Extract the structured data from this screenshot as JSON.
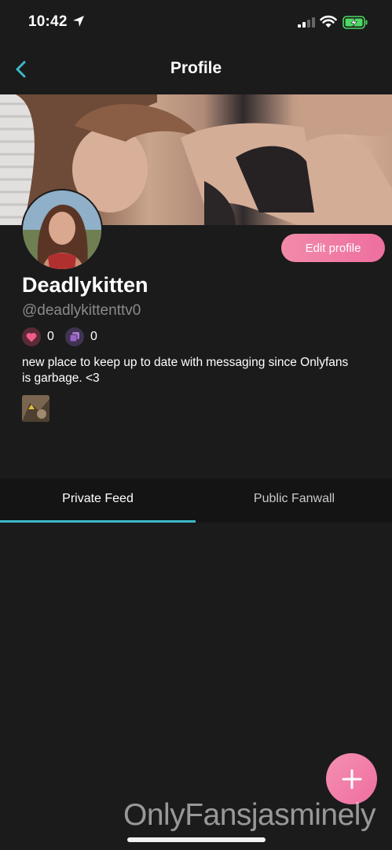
{
  "status_bar": {
    "time": "10:42",
    "icons": [
      "location-arrow-icon",
      "cellular-signal-icon",
      "wifi-icon",
      "battery-charging-icon"
    ],
    "battery_color": "#4cd964"
  },
  "navbar": {
    "title": "Profile",
    "back_icon": "chevron-left-icon",
    "accent": "#3cb8c8"
  },
  "profile": {
    "display_name": "Deadlykitten",
    "handle": "@deadlykittenttv0",
    "edit_label": "Edit profile",
    "likes_count": "0",
    "posts_count": "0",
    "bio": "new place to keep up to date with messaging since Onlyfans is garbage. <3"
  },
  "tabs": [
    {
      "label": "Private Feed",
      "active": true
    },
    {
      "label": "Public Fanwall",
      "active": false
    }
  ],
  "fab": {
    "icon": "plus-icon",
    "color": "#f07aa6"
  },
  "watermark": "OnlyFansjasminely",
  "colors": {
    "background": "#1b1b1b",
    "pink": "#f07aa6",
    "teal": "#3cb8c8"
  }
}
